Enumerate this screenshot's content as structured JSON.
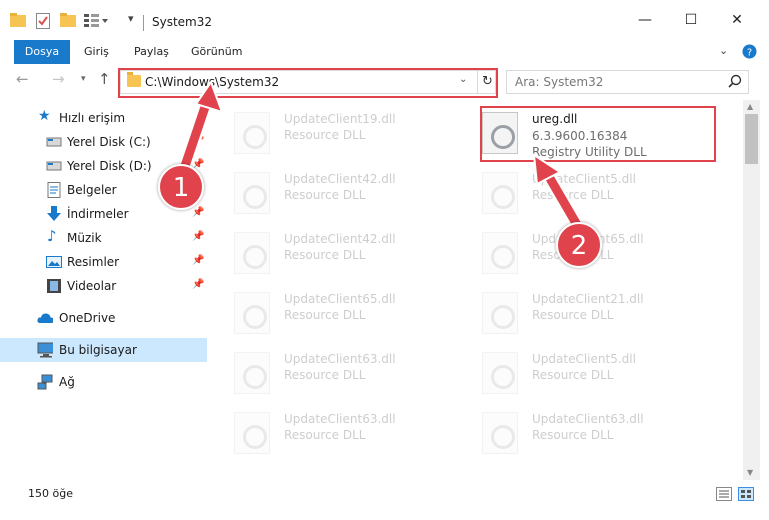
{
  "window": {
    "title": "System32",
    "controls": {
      "minimize": "—",
      "maximize": "☐",
      "close": "✕"
    }
  },
  "ribbon": {
    "tabs": [
      "Dosya",
      "Giriş",
      "Paylaş",
      "Görünüm"
    ],
    "expand_icon": "chevron-down-icon",
    "help_icon": "help-icon"
  },
  "address": {
    "path": "C:\\Windows\\System32",
    "refresh_glyph": "↻"
  },
  "search": {
    "placeholder": "Ara: System32"
  },
  "sidebar": {
    "items": [
      {
        "label": "Hızlı erişim",
        "icon": "star-icon"
      },
      {
        "label": "Yerel Disk (C:)",
        "icon": "drive-icon",
        "pinned": true
      },
      {
        "label": "Yerel Disk (D:)",
        "icon": "drive-icon",
        "pinned": true
      },
      {
        "label": "Belgeler",
        "icon": "document-icon",
        "pinned": true
      },
      {
        "label": "İndirmeler",
        "icon": "download-icon",
        "pinned": true
      },
      {
        "label": "Müzik",
        "icon": "music-icon",
        "pinned": true
      },
      {
        "label": "Resimler",
        "icon": "pictures-icon",
        "pinned": true
      },
      {
        "label": "Videolar",
        "icon": "video-icon",
        "pinned": true
      },
      {
        "label": "OneDrive",
        "icon": "cloud-icon"
      },
      {
        "label": "Bu bilgisayar",
        "icon": "computer-icon",
        "selected": true
      },
      {
        "label": "Ağ",
        "icon": "network-icon"
      }
    ]
  },
  "files": {
    "left": [
      {
        "name": "UpdateClient19.dll",
        "desc": "Resource DLL"
      },
      {
        "name": "UpdateClient42.dll",
        "desc": "Resource DLL"
      },
      {
        "name": "UpdateClient42.dll",
        "desc": "Resource DLL"
      },
      {
        "name": "UpdateClient65.dll",
        "desc": "Resource DLL"
      },
      {
        "name": "UpdateClient63.dll",
        "desc": "Resource DLL"
      },
      {
        "name": "UpdateClient63.dll",
        "desc": "Resource DLL"
      }
    ],
    "right": [
      {
        "name": "ureg.dll",
        "version": "6.3.9600.16384",
        "desc": "Registry Utility DLL"
      },
      {
        "name": "UpdateClient5.dll",
        "desc": "Resource DLL"
      },
      {
        "name": "UpdateClient65.dll",
        "desc": "Resource DLL"
      },
      {
        "name": "UpdateClient21.dll",
        "desc": "Resource DLL"
      },
      {
        "name": "UpdateClient5.dll",
        "desc": "Resource DLL"
      },
      {
        "name": "UpdateClient63.dll",
        "desc": "Resource DLL"
      }
    ]
  },
  "status": {
    "item_count": "150 öğe"
  },
  "annotations": {
    "badge1": "1",
    "badge2": "2",
    "accent": "#e0434b"
  }
}
